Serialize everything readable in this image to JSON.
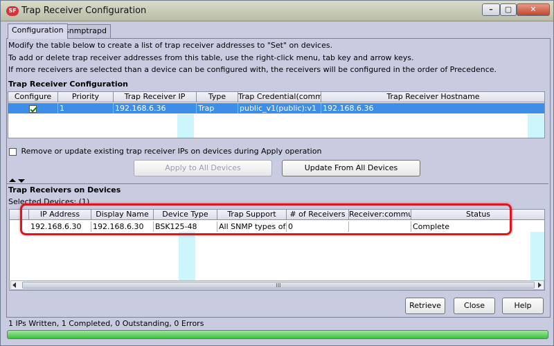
{
  "window": {
    "title": "Trap Receiver Configuration",
    "app_icon": "SF",
    "controls": {
      "minimize": "–",
      "maximize": "▢",
      "close": "✕"
    }
  },
  "tabs": [
    {
      "label": "Configuration",
      "active": true
    },
    {
      "label": "snmptrapd",
      "active": false
    }
  ],
  "instructions": [
    "Modify the table below to create a list of trap receiver addresses to \"Set\" on devices.",
    "To add or delete trap receiver addresses from this table, use the right-click menu, tab key and arrow keys.",
    "If more receivers are selected than a device can be configured with, the receivers will be configured in the order of Precedence."
  ],
  "receiver_config": {
    "title": "Trap Receiver Configuration",
    "columns": [
      "Configure",
      "Priority",
      "Trap Receiver IP",
      "Type",
      "Trap Credential(comm...",
      "Trap Receiver Hostname"
    ],
    "rows": [
      {
        "configure": true,
        "priority": "1",
        "ip": "192.168.6.36",
        "type": "Trap",
        "credential": "public_v1(public):v1",
        "hostname": "192.168.6.36"
      }
    ]
  },
  "remove_option": {
    "label": "Remove or update existing trap receiver IPs on devices during Apply operation",
    "checked": false
  },
  "buttons": {
    "apply_all": "Apply to All Devices",
    "update_all": "Update From All Devices",
    "retrieve": "Retrieve",
    "close": "Close",
    "help": "Help"
  },
  "devices_section": {
    "title": "Trap Receivers on Devices",
    "selected_label": "Selected Devices: (1)",
    "columns": [
      "IP Address",
      "Display Name",
      "Device Type",
      "Trap Support",
      "# of Receivers",
      "Receiver:commu...",
      "Status"
    ],
    "rows": [
      {
        "ip": "192.168.6.30",
        "display_name": "192.168.6.30",
        "device_type": "BSK125-48",
        "trap_support": "All SNMP types of...",
        "receivers": "0",
        "receiver_comm": "",
        "status": "Complete"
      }
    ]
  },
  "scrollbar": {
    "grip": "III"
  },
  "status_bar": {
    "text": "1 IPs Written, 1 Completed, 0 Outstanding, 0 Errors",
    "progress": 1.0
  },
  "colors": {
    "selection": "#3d8ee8",
    "highlight_box": "#e0141e",
    "progress": "#3fbf3f"
  }
}
